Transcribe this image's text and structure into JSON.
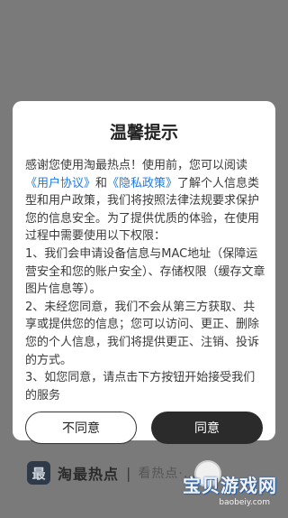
{
  "dialog": {
    "title": "温馨提示",
    "intro_1": "感谢您使用淘最热点！使用前，您可以阅读",
    "user_agreement": "《用户协议》",
    "and": "和",
    "privacy_policy": "《隐私政策》",
    "intro_2": "了解个人信息类型和用户政策，我们将按照法律法规要求保护您的信息安全。为了提供优质的体验，在使用过程中需要使用以下权限：",
    "item_1": "1、我们会申请设备信息与MAC地址（保障运营安全和您的账户安全）、存储权限（缓存文章图片信息等）。",
    "item_2": "2、未经您同意，我们不会从第三方获取、共享或提供您的信息；您可以访问、更正、删除您的个人信息，我们将提供更正、注销、投诉的方式。",
    "item_3": "3、如您同意，请点击下方按钮开始接受我们的服务",
    "disagree_label": "不同意",
    "agree_label": "同意"
  },
  "footer": {
    "logo_char": "最",
    "app_name": "淘最热点",
    "separator": "|",
    "slogan": "看热点·…"
  },
  "watermark": {
    "title": "宝贝游戏网",
    "url": "baobeiy.com"
  }
}
